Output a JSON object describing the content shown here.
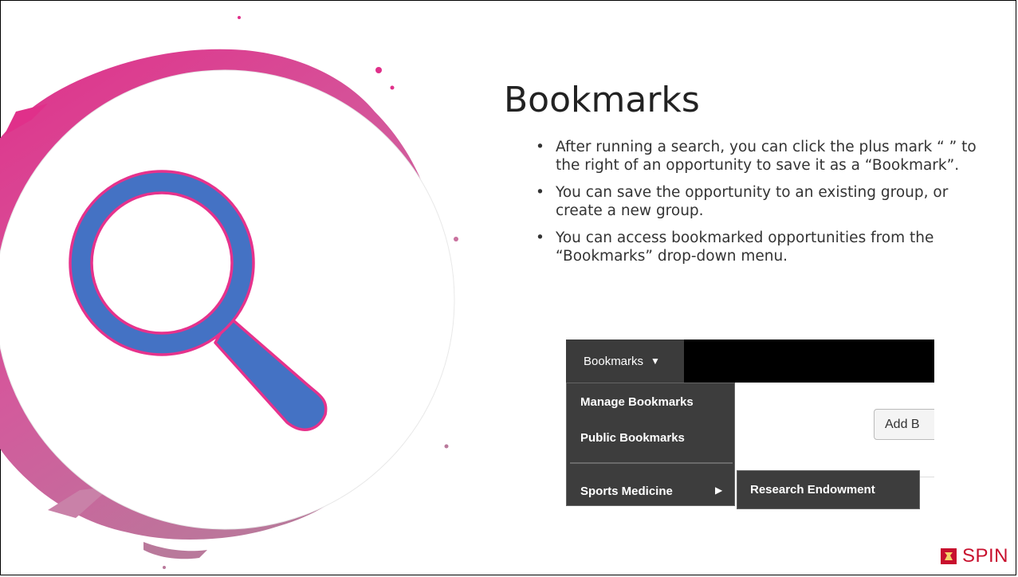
{
  "slide": {
    "title": "Bookmarks",
    "bullets": [
      "After running a search, you can click the plus mark “ ” to the right of an opportunity to save it as a “Bookmark”.",
      "You can save the opportunity to an existing group, or create a new group.",
      "You can access bookmarked opportunities from the “Bookmarks” drop-down menu."
    ],
    "bullet_glyph": "•"
  },
  "screenshot": {
    "tab_label": "Bookmarks",
    "tab_caret": "▼",
    "menu_items": [
      "Manage Bookmarks",
      "Public Bookmarks"
    ],
    "group_item": "Sports Medicine",
    "group_arrow": "▶",
    "submenu_item": "Research Endowment",
    "add_button_label": "Add B"
  },
  "branding": {
    "logo_text": "SPIN",
    "logo_color": "#c8102e"
  },
  "colors": {
    "magnifier_fill": "#4472c4",
    "magnifier_outline": "#e6328c",
    "splash_pink": "#e0308a",
    "splash_mauve": "#b9799b"
  },
  "icons": [
    "magnifying-glass-icon",
    "spin-logo-icon"
  ]
}
